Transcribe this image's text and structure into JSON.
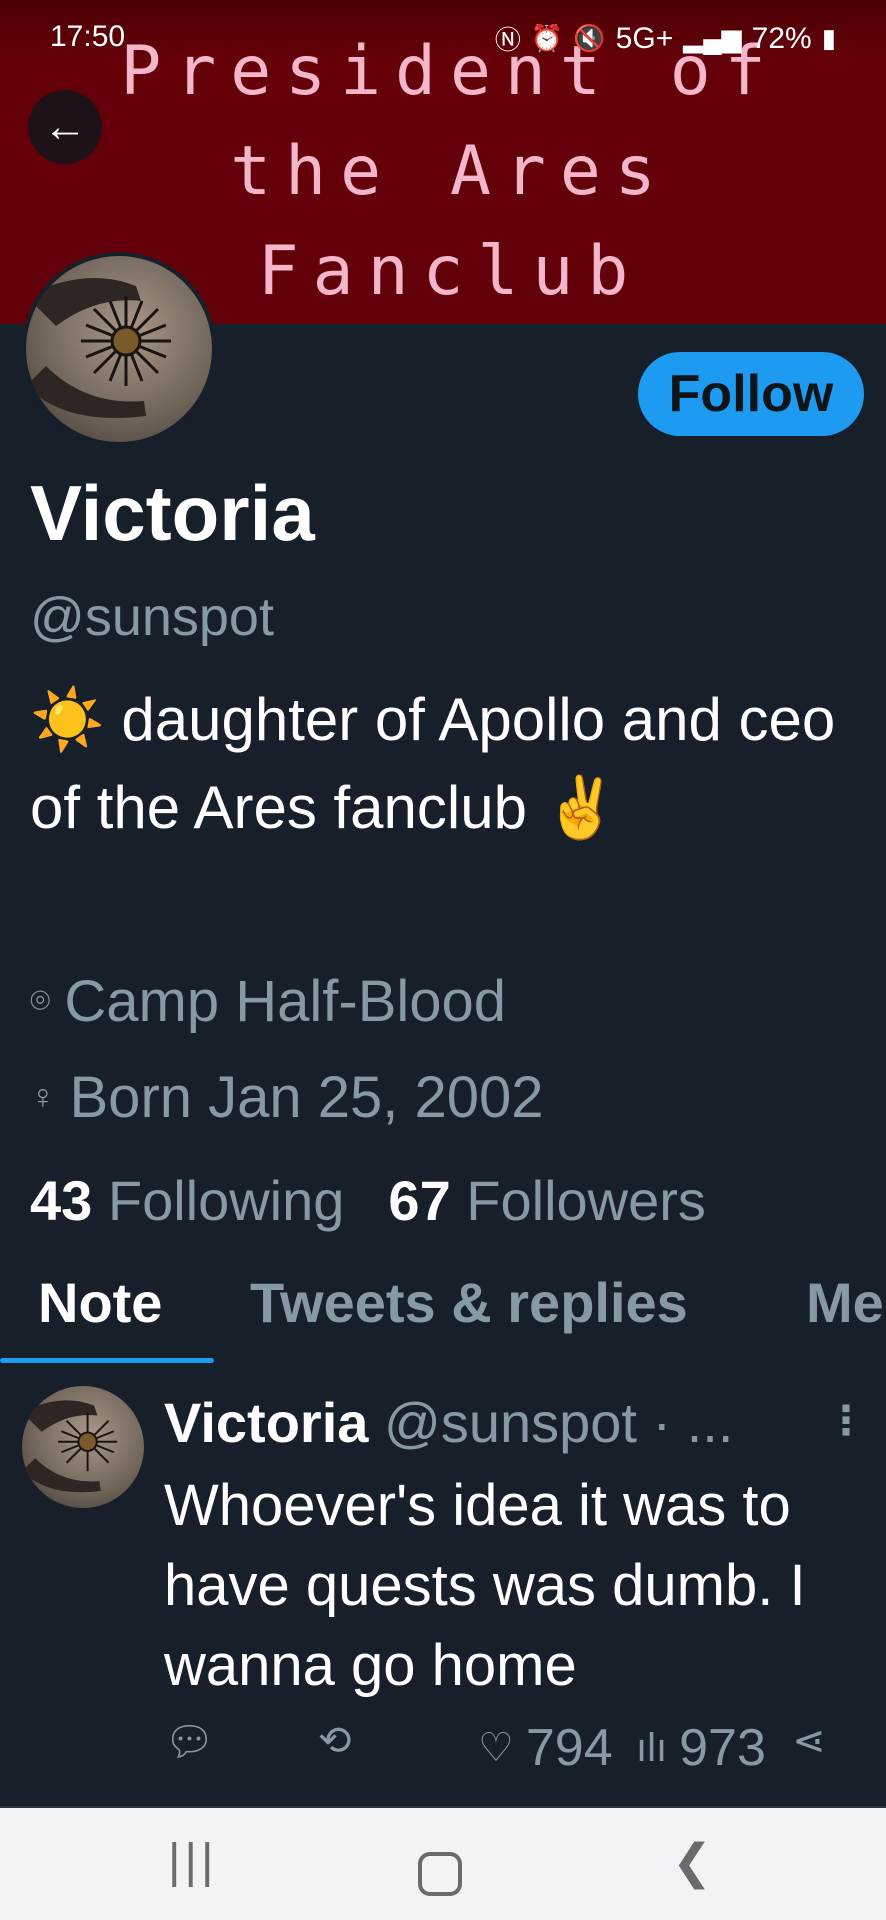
{
  "status_bar": {
    "time": "17:50",
    "network": "5G+",
    "battery": "72%",
    "icons": [
      "nfc-icon",
      "alarm-icon",
      "mute-icon",
      "signal-icon",
      "battery-icon"
    ]
  },
  "banner": {
    "lines": [
      "President of",
      "the Ares",
      "Fanclub"
    ],
    "bg_color": "#62000a",
    "text_color": "#f3b7c9"
  },
  "profile": {
    "name": "Victoria",
    "handle": "@sunspot",
    "follow_label": "Follow",
    "bio_emoji_start": "☀️",
    "bio_text": "daughter of Apollo and ceo of the Ares fanclub",
    "bio_emoji_end": "✌️",
    "location": "Camp Half-Blood",
    "birthday": "Born Jan 25, 2002",
    "following_count": "43",
    "following_label": "Following",
    "followers_count": "67",
    "followers_label": "Followers"
  },
  "tabs": [
    {
      "label": "Note",
      "active": true
    },
    {
      "label": "Tweets & replies",
      "active": false
    },
    {
      "label": "Me",
      "active": false
    }
  ],
  "tweet": {
    "name": "Victoria",
    "handle": "@sunspot",
    "separator": "· ...",
    "text": "Whoever's idea it was to have quests was dumb. I wanna go home",
    "likes": "794",
    "views": "973"
  },
  "colors": {
    "background": "#17202a",
    "accent": "#1d9bf0",
    "secondary_text": "#8899a6"
  }
}
